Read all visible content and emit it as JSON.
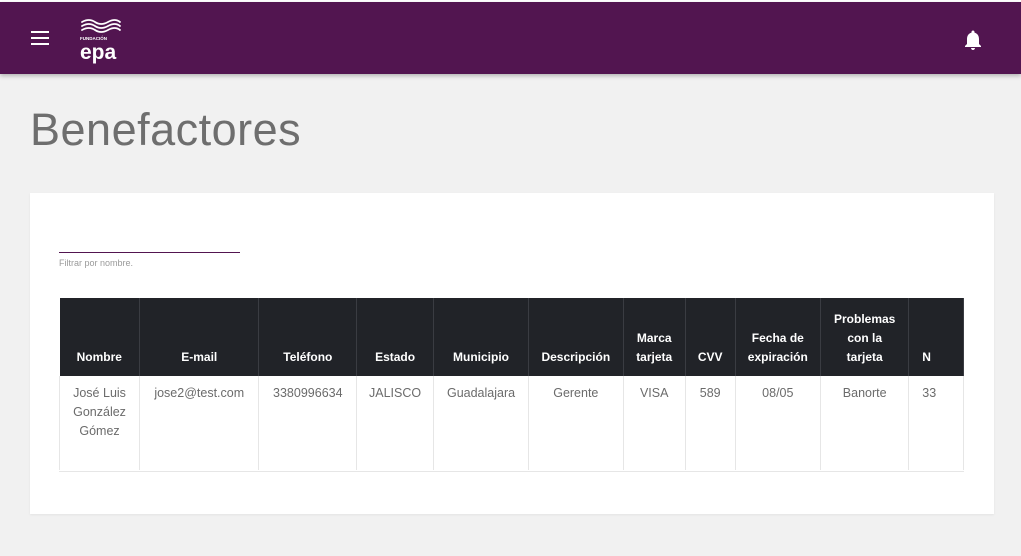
{
  "app": {
    "logo_small_text": "FUNDACIÓN",
    "logo_text": "epa",
    "brand_color": "#521550"
  },
  "page": {
    "title": "Benefactores"
  },
  "filter": {
    "placeholder": "",
    "hint": "Filtrar por nombre."
  },
  "table": {
    "headers": [
      "Nombre",
      "E-mail",
      "Teléfono",
      "Estado",
      "Municipio",
      "Descripción",
      "Marca tarjeta",
      "CVV",
      "Fecha de expiración",
      "Problemas con la tarjeta",
      "N"
    ],
    "rows": [
      {
        "nombre": "José Luis González Gómez",
        "email": "jose2@test.com",
        "telefono": "3380996634",
        "estado": "JALISCO",
        "municipio": "Guadalajara",
        "descripcion": "Gerente",
        "marca": "VISA",
        "cvv": "589",
        "fecha": "08/05",
        "problemas": "Banorte",
        "extra": "33"
      }
    ]
  },
  "icons": {
    "menu": "menu-icon",
    "bell": "bell-icon"
  }
}
